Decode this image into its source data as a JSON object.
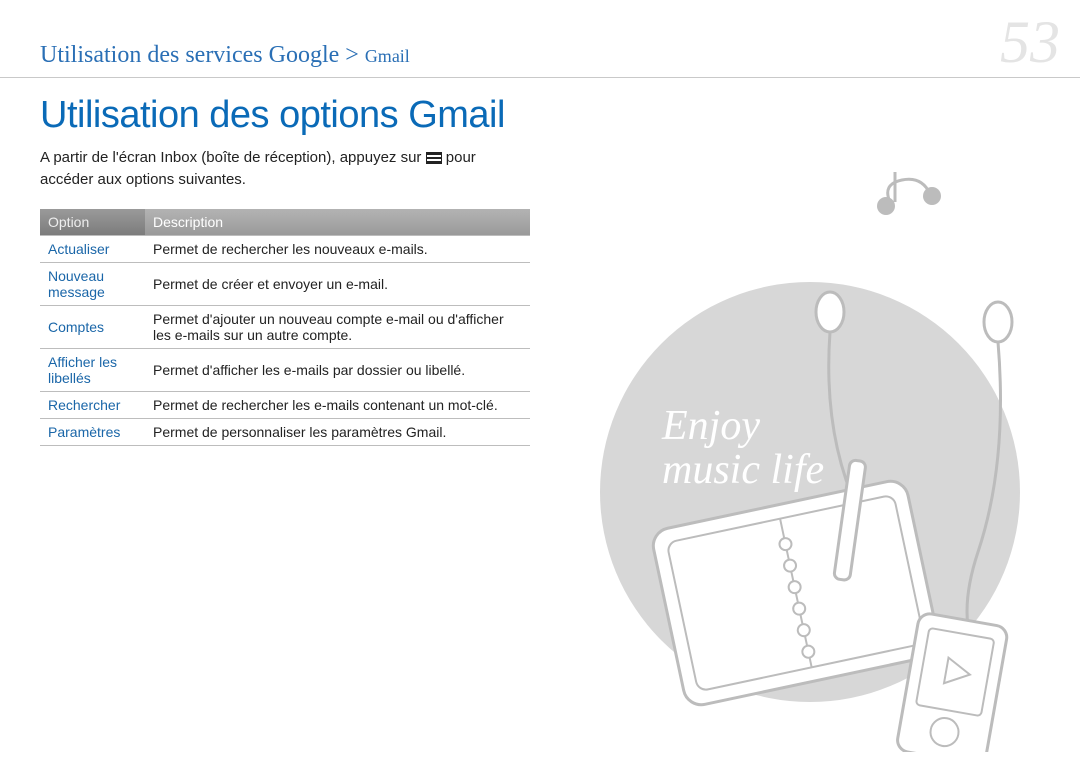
{
  "header": {
    "breadcrumb_main": "Utilisation des services Google > ",
    "breadcrumb_sub": "Gmail",
    "page_number": "53"
  },
  "main": {
    "title": "Utilisation des options Gmail",
    "intro_before_icon": "A partir de l'écran Inbox (boîte de réception), appuyez sur ",
    "intro_after_icon": " pour accéder aux options suivantes."
  },
  "table": {
    "header_option": "Option",
    "header_description": "Description",
    "rows": [
      {
        "option": "Actualiser",
        "description": "Permet de rechercher les nouveaux e-mails."
      },
      {
        "option": "Nouveau message",
        "description": "Permet de créer et envoyer un e-mail."
      },
      {
        "option": "Comptes",
        "description": "Permet d'ajouter un nouveau compte e-mail ou d'afficher les e-mails sur un autre compte."
      },
      {
        "option": "Afficher les libellés",
        "description": "Permet d'afficher les e-mails par dossier ou libellé."
      },
      {
        "option": "Rechercher",
        "description": "Permet de rechercher les e-mails contenant un mot-clé."
      },
      {
        "option": "Paramètres",
        "description": "Permet de personnaliser les paramètres Gmail."
      }
    ]
  },
  "illustration": {
    "tagline_line1": "Enjoy",
    "tagline_line2": "music life"
  }
}
